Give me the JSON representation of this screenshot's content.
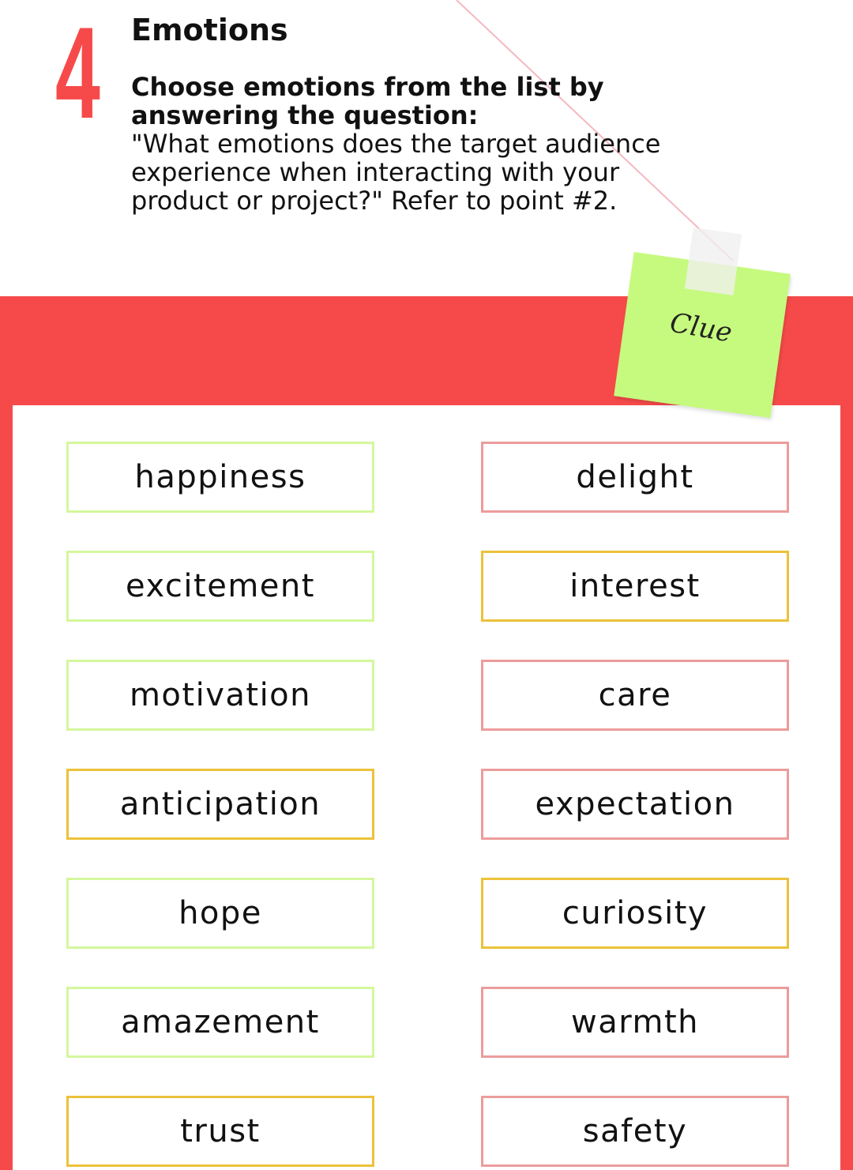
{
  "section": {
    "number": "4",
    "title": "Emotions",
    "subtitle": "Choose emotions from the list by answering the question:",
    "question": "\"What emotions does the target audience experience when interacting with your product or project?\" Refer to point #2."
  },
  "sticky_note": {
    "label": "Clue"
  },
  "colors": {
    "accent_red": "#f64a4a",
    "sticky_green": "#c6fa7e",
    "border_green": "#d4f79c",
    "border_pink": "#ec9c9c",
    "border_yellow": "#ecc23a"
  },
  "emotions": {
    "left": [
      {
        "label": "happiness",
        "color": "green"
      },
      {
        "label": "excitement",
        "color": "green"
      },
      {
        "label": "motivation",
        "color": "green"
      },
      {
        "label": "anticipation",
        "color": "yellow"
      },
      {
        "label": "hope",
        "color": "green"
      },
      {
        "label": "amazement",
        "color": "green"
      },
      {
        "label": "trust",
        "color": "yellow"
      }
    ],
    "right": [
      {
        "label": "delight",
        "color": "pink"
      },
      {
        "label": "interest",
        "color": "yellow"
      },
      {
        "label": "care",
        "color": "pink"
      },
      {
        "label": "expectation",
        "color": "pink"
      },
      {
        "label": "curiosity",
        "color": "yellow"
      },
      {
        "label": "warmth",
        "color": "pink"
      },
      {
        "label": "safety",
        "color": "pink"
      }
    ]
  }
}
